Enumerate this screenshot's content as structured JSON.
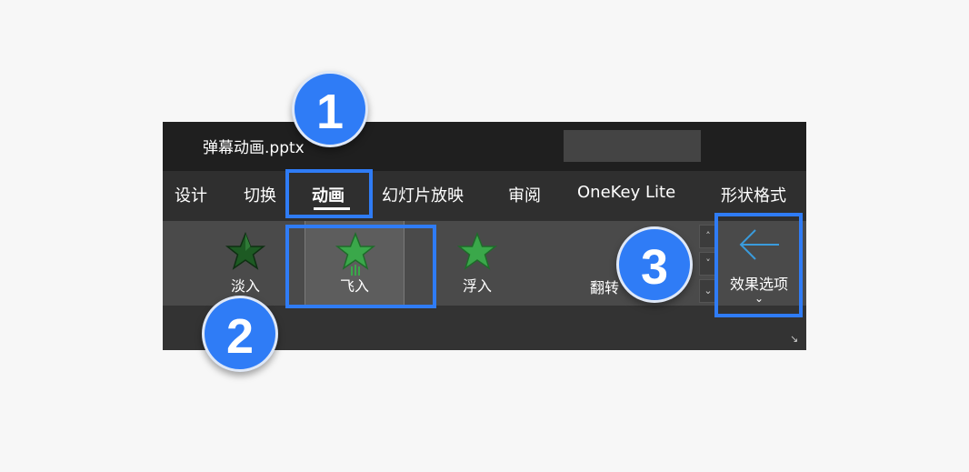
{
  "window": {
    "title": "弹幕动画.pptx"
  },
  "tabs": [
    {
      "label": "设计",
      "active": false
    },
    {
      "label": "切换",
      "active": false
    },
    {
      "label": "动画",
      "active": true
    },
    {
      "label": "幻灯片放映",
      "active": false
    },
    {
      "label": "审阅",
      "active": false
    },
    {
      "label": "OneKey Lite",
      "active": false
    },
    {
      "label": "形状格式",
      "active": false
    }
  ],
  "gallery": {
    "items": [
      {
        "label": "淡入",
        "icon": "star-icon",
        "selected": false,
        "color": "#2a6e2f"
      },
      {
        "label": "飞入",
        "icon": "star-fly-icon",
        "selected": true,
        "color": "#3aa84a"
      },
      {
        "label": "浮入",
        "icon": "star-icon",
        "selected": false,
        "color": "#3aa84a"
      }
    ],
    "partial_label": "翻转"
  },
  "effect_options": {
    "label": "效果选项",
    "icon": "arrow-left-icon",
    "chevron": "⌄"
  },
  "scroll_buttons": [
    "˄",
    "˅",
    "⌄"
  ],
  "dialog_launcher": "↘",
  "annotations": {
    "badges": [
      "1",
      "2",
      "3"
    ],
    "accent": "#2f7cf6"
  }
}
